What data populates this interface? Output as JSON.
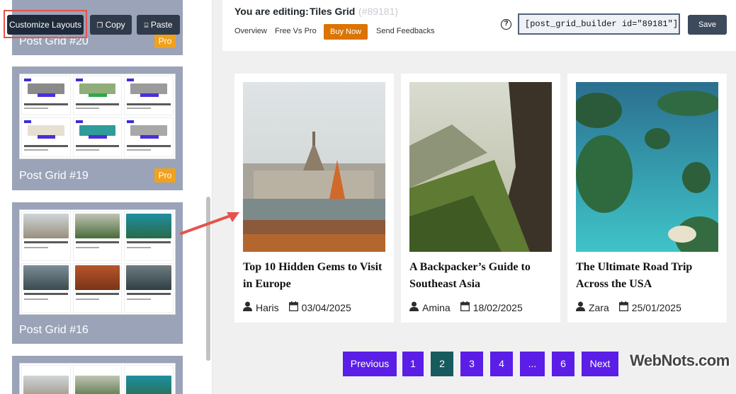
{
  "toolbar": {
    "customize_label": "Customize Layouts",
    "copy_label": "Copy",
    "paste_label": "Paste"
  },
  "sidebar": {
    "layouts": [
      {
        "label": "Post Grid #20",
        "badge": "Pro"
      },
      {
        "label": "Post Grid #19",
        "badge": "Pro"
      },
      {
        "label": "Post Grid #16",
        "badge": ""
      }
    ]
  },
  "header": {
    "editing_label": "You are editing:",
    "layout_name": "Tiles Grid",
    "layout_id": "(#89181)",
    "nav": [
      "Overview",
      "Free Vs Pro",
      "Buy Now",
      "Send Feedbacks"
    ],
    "help_symbol": "?",
    "shortcode": "[post_grid_builder id=\"89181\"]",
    "save_label": "Save"
  },
  "posts": [
    {
      "title": "Top 10 Hidden Gems to Visit in Europe",
      "author": "Haris",
      "date": "03/04/2025"
    },
    {
      "title": "A Backpacker’s Guide to Southeast Asia",
      "author": "Amina",
      "date": "18/02/2025"
    },
    {
      "title": "The Ultimate Road Trip Across the USA",
      "author": "Zara",
      "date": "25/01/2025"
    }
  ],
  "pagination": {
    "previous": "Previous",
    "pages": [
      "1",
      "2",
      "3",
      "4",
      "...",
      "6"
    ],
    "active_page": "2",
    "next": "Next"
  },
  "watermark": "WebNots.com",
  "colors": {
    "primary_purple": "#5b1ee6",
    "active_page": "#175b5e",
    "buy_now": "#db7400",
    "pro_badge": "#f0a11d",
    "highlight_red": "#e5534b"
  }
}
